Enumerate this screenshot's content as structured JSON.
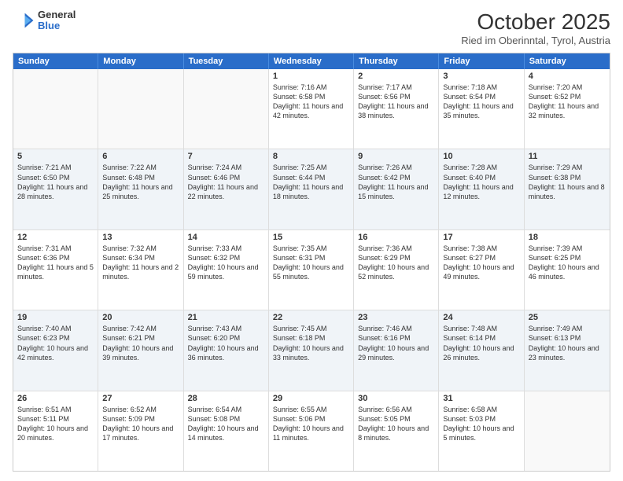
{
  "header": {
    "logo_general": "General",
    "logo_blue": "Blue",
    "title": "October 2025",
    "subtitle": "Ried im Oberinntal, Tyrol, Austria"
  },
  "weekdays": [
    "Sunday",
    "Monday",
    "Tuesday",
    "Wednesday",
    "Thursday",
    "Friday",
    "Saturday"
  ],
  "rows": [
    {
      "alt": false,
      "cells": [
        {
          "day": "",
          "sunrise": "",
          "sunset": "",
          "daylight": ""
        },
        {
          "day": "",
          "sunrise": "",
          "sunset": "",
          "daylight": ""
        },
        {
          "day": "",
          "sunrise": "",
          "sunset": "",
          "daylight": ""
        },
        {
          "day": "1",
          "sunrise": "Sunrise: 7:16 AM",
          "sunset": "Sunset: 6:58 PM",
          "daylight": "Daylight: 11 hours and 42 minutes."
        },
        {
          "day": "2",
          "sunrise": "Sunrise: 7:17 AM",
          "sunset": "Sunset: 6:56 PM",
          "daylight": "Daylight: 11 hours and 38 minutes."
        },
        {
          "day": "3",
          "sunrise": "Sunrise: 7:18 AM",
          "sunset": "Sunset: 6:54 PM",
          "daylight": "Daylight: 11 hours and 35 minutes."
        },
        {
          "day": "4",
          "sunrise": "Sunrise: 7:20 AM",
          "sunset": "Sunset: 6:52 PM",
          "daylight": "Daylight: 11 hours and 32 minutes."
        }
      ]
    },
    {
      "alt": true,
      "cells": [
        {
          "day": "5",
          "sunrise": "Sunrise: 7:21 AM",
          "sunset": "Sunset: 6:50 PM",
          "daylight": "Daylight: 11 hours and 28 minutes."
        },
        {
          "day": "6",
          "sunrise": "Sunrise: 7:22 AM",
          "sunset": "Sunset: 6:48 PM",
          "daylight": "Daylight: 11 hours and 25 minutes."
        },
        {
          "day": "7",
          "sunrise": "Sunrise: 7:24 AM",
          "sunset": "Sunset: 6:46 PM",
          "daylight": "Daylight: 11 hours and 22 minutes."
        },
        {
          "day": "8",
          "sunrise": "Sunrise: 7:25 AM",
          "sunset": "Sunset: 6:44 PM",
          "daylight": "Daylight: 11 hours and 18 minutes."
        },
        {
          "day": "9",
          "sunrise": "Sunrise: 7:26 AM",
          "sunset": "Sunset: 6:42 PM",
          "daylight": "Daylight: 11 hours and 15 minutes."
        },
        {
          "day": "10",
          "sunrise": "Sunrise: 7:28 AM",
          "sunset": "Sunset: 6:40 PM",
          "daylight": "Daylight: 11 hours and 12 minutes."
        },
        {
          "day": "11",
          "sunrise": "Sunrise: 7:29 AM",
          "sunset": "Sunset: 6:38 PM",
          "daylight": "Daylight: 11 hours and 8 minutes."
        }
      ]
    },
    {
      "alt": false,
      "cells": [
        {
          "day": "12",
          "sunrise": "Sunrise: 7:31 AM",
          "sunset": "Sunset: 6:36 PM",
          "daylight": "Daylight: 11 hours and 5 minutes."
        },
        {
          "day": "13",
          "sunrise": "Sunrise: 7:32 AM",
          "sunset": "Sunset: 6:34 PM",
          "daylight": "Daylight: 11 hours and 2 minutes."
        },
        {
          "day": "14",
          "sunrise": "Sunrise: 7:33 AM",
          "sunset": "Sunset: 6:32 PM",
          "daylight": "Daylight: 10 hours and 59 minutes."
        },
        {
          "day": "15",
          "sunrise": "Sunrise: 7:35 AM",
          "sunset": "Sunset: 6:31 PM",
          "daylight": "Daylight: 10 hours and 55 minutes."
        },
        {
          "day": "16",
          "sunrise": "Sunrise: 7:36 AM",
          "sunset": "Sunset: 6:29 PM",
          "daylight": "Daylight: 10 hours and 52 minutes."
        },
        {
          "day": "17",
          "sunrise": "Sunrise: 7:38 AM",
          "sunset": "Sunset: 6:27 PM",
          "daylight": "Daylight: 10 hours and 49 minutes."
        },
        {
          "day": "18",
          "sunrise": "Sunrise: 7:39 AM",
          "sunset": "Sunset: 6:25 PM",
          "daylight": "Daylight: 10 hours and 46 minutes."
        }
      ]
    },
    {
      "alt": true,
      "cells": [
        {
          "day": "19",
          "sunrise": "Sunrise: 7:40 AM",
          "sunset": "Sunset: 6:23 PM",
          "daylight": "Daylight: 10 hours and 42 minutes."
        },
        {
          "day": "20",
          "sunrise": "Sunrise: 7:42 AM",
          "sunset": "Sunset: 6:21 PM",
          "daylight": "Daylight: 10 hours and 39 minutes."
        },
        {
          "day": "21",
          "sunrise": "Sunrise: 7:43 AM",
          "sunset": "Sunset: 6:20 PM",
          "daylight": "Daylight: 10 hours and 36 minutes."
        },
        {
          "day": "22",
          "sunrise": "Sunrise: 7:45 AM",
          "sunset": "Sunset: 6:18 PM",
          "daylight": "Daylight: 10 hours and 33 minutes."
        },
        {
          "day": "23",
          "sunrise": "Sunrise: 7:46 AM",
          "sunset": "Sunset: 6:16 PM",
          "daylight": "Daylight: 10 hours and 29 minutes."
        },
        {
          "day": "24",
          "sunrise": "Sunrise: 7:48 AM",
          "sunset": "Sunset: 6:14 PM",
          "daylight": "Daylight: 10 hours and 26 minutes."
        },
        {
          "day": "25",
          "sunrise": "Sunrise: 7:49 AM",
          "sunset": "Sunset: 6:13 PM",
          "daylight": "Daylight: 10 hours and 23 minutes."
        }
      ]
    },
    {
      "alt": false,
      "cells": [
        {
          "day": "26",
          "sunrise": "Sunrise: 6:51 AM",
          "sunset": "Sunset: 5:11 PM",
          "daylight": "Daylight: 10 hours and 20 minutes."
        },
        {
          "day": "27",
          "sunrise": "Sunrise: 6:52 AM",
          "sunset": "Sunset: 5:09 PM",
          "daylight": "Daylight: 10 hours and 17 minutes."
        },
        {
          "day": "28",
          "sunrise": "Sunrise: 6:54 AM",
          "sunset": "Sunset: 5:08 PM",
          "daylight": "Daylight: 10 hours and 14 minutes."
        },
        {
          "day": "29",
          "sunrise": "Sunrise: 6:55 AM",
          "sunset": "Sunset: 5:06 PM",
          "daylight": "Daylight: 10 hours and 11 minutes."
        },
        {
          "day": "30",
          "sunrise": "Sunrise: 6:56 AM",
          "sunset": "Sunset: 5:05 PM",
          "daylight": "Daylight: 10 hours and 8 minutes."
        },
        {
          "day": "31",
          "sunrise": "Sunrise: 6:58 AM",
          "sunset": "Sunset: 5:03 PM",
          "daylight": "Daylight: 10 hours and 5 minutes."
        },
        {
          "day": "",
          "sunrise": "",
          "sunset": "",
          "daylight": ""
        }
      ]
    }
  ]
}
